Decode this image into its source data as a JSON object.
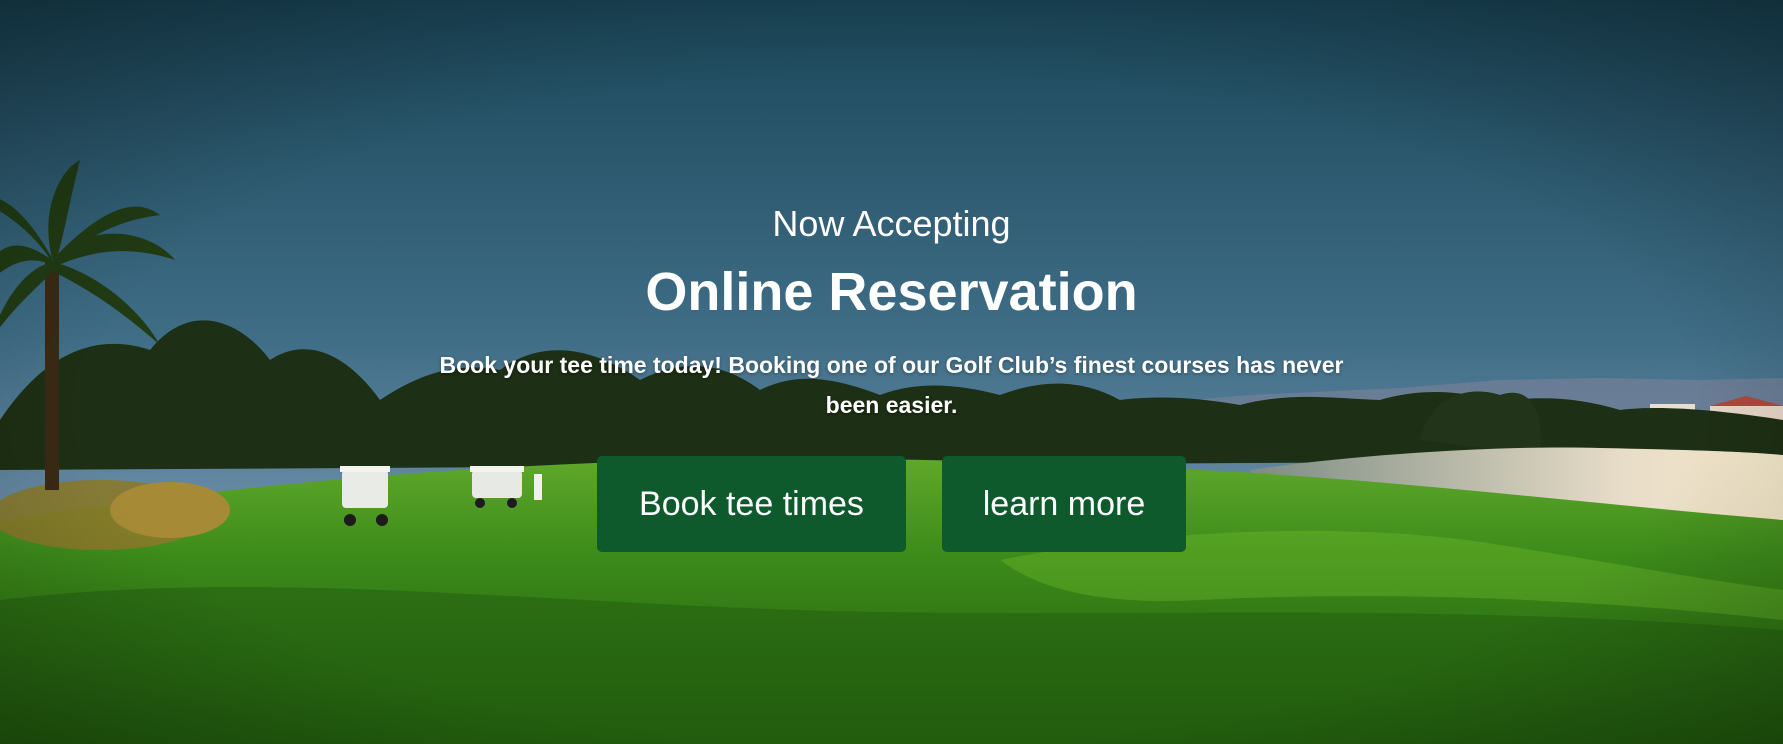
{
  "hero": {
    "eyebrow": "Now Accepting",
    "headline": "Online Reservation",
    "description": "Book your tee time today! Booking one of our Golf Club’s finest courses has never been easier.",
    "primary_button": "Book tee times",
    "secondary_button": "learn more"
  },
  "colors": {
    "button_bg": "#0e5a2c",
    "sky_top": "#1b4a5e",
    "grass": "#3f8f1e"
  }
}
